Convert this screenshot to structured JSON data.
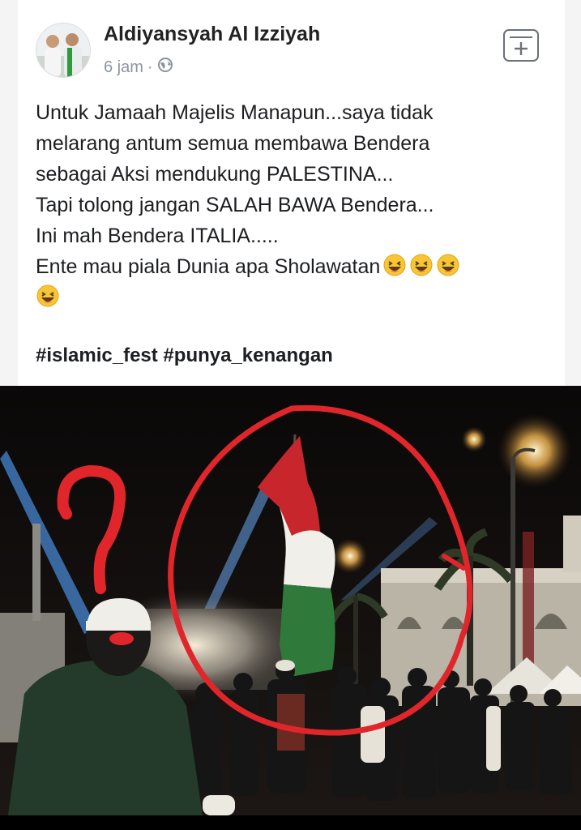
{
  "post": {
    "author": "Aldiyansyah Al Izziyah",
    "time": "6 jam",
    "separator": "·",
    "privacy_icon": "globe-icon",
    "save_icon": "save-post-icon",
    "lines": [
      "Untuk Jamaah Majelis Manapun...saya tidak",
      "melarang antum semua membawa Bendera",
      "sebagai Aksi mendukung PALESTINA...",
      "Tapi tolong jangan SALAH BAWA Bendera...",
      "Ini mah Bendera ITALIA.....",
      "Ente mau piala Dunia apa Sholawatan"
    ],
    "emoji": "laughing-emoji",
    "hashtags": "#islamic_fest #punya_kenangan"
  },
  "photo": {
    "flag_colors": [
      "#c8262d",
      "#f1efe9",
      "#2f7a3a"
    ],
    "annotation_color": "#e1262b"
  }
}
